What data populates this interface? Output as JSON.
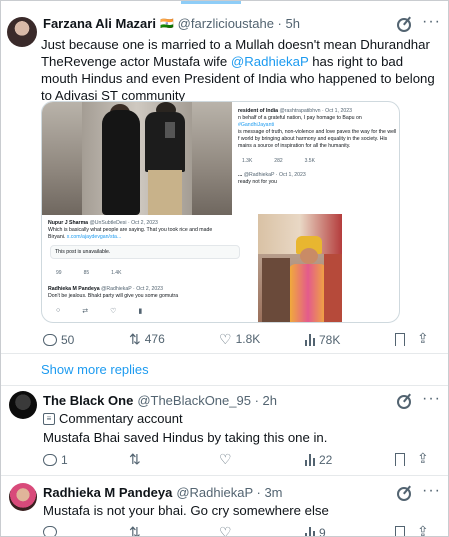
{
  "main_tweet": {
    "author_name": "Farzana Ali Mazari",
    "flag_emoji": "🇮🇳",
    "handle_time": "@farzlicioustahe · 5h",
    "text_part1": "Just because one is married to a Mullah doesn't mean Dhurandhar TheRevenge actor Mustafa wife ",
    "mention": "@RadhiekaP",
    "text_part2": " has right to bad mouth Hindus and even President of India who happened to belong to Adivasi ST community",
    "stats": {
      "replies": "50",
      "reposts": "476",
      "likes": "1.8K",
      "views": "78K"
    }
  },
  "embedded": {
    "president_name": "resident of India",
    "president_handle": "@rashtrapatibhvn · Oct 1, 2023",
    "president_text_1": "n behalf of a grateful nation, I pay homage to Bapu on ",
    "president_tag": "#GandhiJayanti",
    "president_text_2": "is message of truth, non-violence and love paves the way for the well",
    "president_text_3": "f world by bringing about harmony and equality in the society. His",
    "president_text_4": "mains a source of inspiration for all the humanity.",
    "president_stats": [
      "1.3K",
      "282",
      "3.5K",
      ""
    ],
    "radhieka_small_name": "...",
    "radhieka_small_handle": "@RadhiekaP · Oct 1, 2023",
    "radhieka_small_text": "ready not for you",
    "nupur_name": "Nupur J Sharma",
    "nupur_handle": "@UnSubtleDesi · Oct 2, 2023",
    "nupur_text_1": "Which is basically what people are saying. That you took rice and made",
    "nupur_text_2": "Biryani. ",
    "nupur_link": "x.com/ajaydevgan/sta...",
    "unavailable": "This post is unavailable.",
    "nupur_stats": [
      "99",
      "85",
      "1.4K",
      ""
    ],
    "reply_name": "Radhieka M Pandeya",
    "reply_handle": "@RadhiekaP · Oct 2, 2023",
    "reply_text": "Don't be jealous. Bhakt party will give you some gomutra",
    "reply_stats": [
      "",
      "",
      "",
      ""
    ]
  },
  "show_more": "Show more replies",
  "reply1": {
    "author_name": "The Black One",
    "handle_time": "@TheBlackOne_95 · 2h",
    "badge": "Commentary account",
    "text": "Mustafa Bhai saved Hindus by taking this one in.",
    "stats": {
      "replies": "1",
      "reposts": "",
      "likes": "",
      "views": "22"
    }
  },
  "reply2": {
    "author_name": "Radhieka M Pandeya",
    "handle_time": "@RadhiekaP · 3m",
    "text": "Mustafa is not your bhai. Go cry somewhere else",
    "stats": {
      "replies": "",
      "reposts": "",
      "likes": "",
      "views": "9"
    }
  },
  "icons": [
    "grok-icon",
    "more-icon",
    "reply-icon",
    "repost-icon",
    "like-icon",
    "views-icon",
    "bookmark-icon",
    "share-icon",
    "commentary-icon"
  ],
  "colors": {
    "link": "#1d9bf0",
    "secondary": "#536471",
    "border": "#cfd9de"
  }
}
